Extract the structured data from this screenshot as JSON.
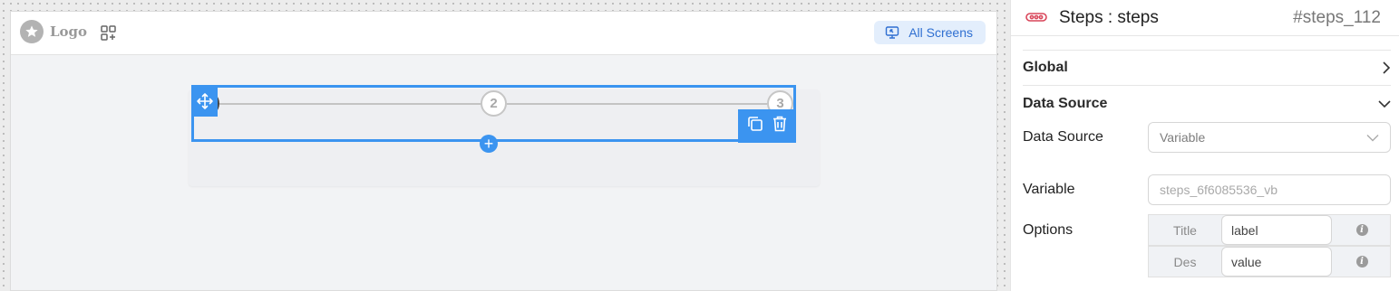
{
  "canvas": {
    "logo_text": "Logo",
    "all_screens_label": "All Screens",
    "steps": [
      "2",
      "3"
    ],
    "add_icon_glyph": "+"
  },
  "panel": {
    "title": "Steps : steps",
    "id": "#steps_112",
    "sections": {
      "global": "Global",
      "data_source": "Data Source"
    },
    "fields": {
      "data_source_label": "Data Source",
      "data_source_value": "Variable",
      "variable_label": "Variable",
      "variable_placeholder": "steps_6f6085536_vb",
      "options_label": "Options"
    },
    "options": [
      {
        "key": "Title",
        "value": "label",
        "info_icon": "i"
      },
      {
        "key": "Des",
        "value": "value",
        "info_icon": "i"
      }
    ]
  },
  "colors": {
    "accent": "#3b94f0",
    "link_blue": "#2f6fd1",
    "steps_icon": "#d9465a"
  }
}
